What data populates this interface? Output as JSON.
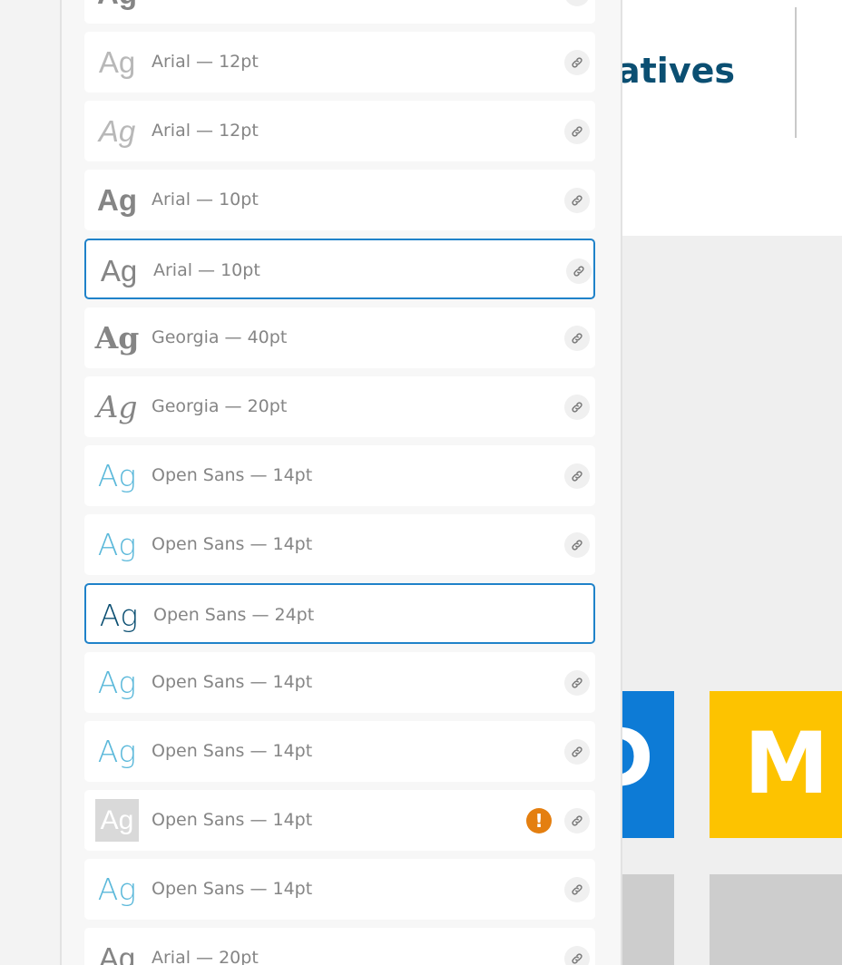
{
  "canvas": {
    "header_title": "atives",
    "tile_blue_letter": "D",
    "tile_yellow_letter": "M",
    "colors": {
      "title": "#0b4f72",
      "tile_blue": "#0d7bd6",
      "tile_yellow": "#fdc300",
      "tile_grey": "#cdcdcd"
    }
  },
  "style_list": {
    "colors": {
      "selected_border": "#1f82c9",
      "warning": "#e47f10",
      "label": "#858585"
    },
    "items": [
      {
        "preview": "Ag",
        "label": "Arial — 12pt",
        "preview_color": "#b8b8b8",
        "font": "sans",
        "weight": "normal",
        "italic": false,
        "selected": false,
        "warning": false,
        "link": true
      },
      {
        "preview": "Ag",
        "label": "Arial — 12pt",
        "preview_color": "#b8b8b8",
        "font": "sans",
        "weight": "normal",
        "italic": true,
        "selected": false,
        "warning": false,
        "link": true
      },
      {
        "preview": "Ag",
        "label": "Arial — 10pt",
        "preview_color": "#858585",
        "font": "sans",
        "weight": "bold",
        "italic": false,
        "selected": false,
        "warning": false,
        "link": true
      },
      {
        "preview": "Ag",
        "label": "Arial — 10pt",
        "preview_color": "#858585",
        "font": "sans",
        "weight": "normal",
        "italic": false,
        "selected": true,
        "warning": false,
        "link": true
      },
      {
        "preview": "Ag",
        "label": "Georgia — 40pt",
        "preview_color": "#858585",
        "font": "serif",
        "weight": "bold",
        "italic": false,
        "selected": false,
        "warning": false,
        "link": true
      },
      {
        "preview": "Ag",
        "label": "Georgia — 20pt",
        "preview_color": "#858585",
        "font": "serif",
        "weight": "normal",
        "italic": true,
        "selected": false,
        "warning": false,
        "link": true
      },
      {
        "preview": "Ag",
        "label": "Open Sans — 14pt",
        "preview_color": "#5ab8da",
        "font": "light",
        "weight": "normal",
        "italic": false,
        "selected": false,
        "warning": false,
        "link": true
      },
      {
        "preview": "Ag",
        "label": "Open Sans — 14pt",
        "preview_color": "#5ab8da",
        "font": "light",
        "weight": "normal",
        "italic": false,
        "selected": false,
        "warning": false,
        "link": true
      },
      {
        "preview": "Ag",
        "label": "Open Sans — 24pt",
        "preview_color": "#0b4f72",
        "font": "light",
        "weight": "normal",
        "italic": false,
        "selected": true,
        "warning": false,
        "link": false
      },
      {
        "preview": "Ag",
        "label": "Open Sans — 14pt",
        "preview_color": "#5ab8da",
        "font": "light",
        "weight": "normal",
        "italic": false,
        "selected": false,
        "warning": false,
        "link": true
      },
      {
        "preview": "Ag",
        "label": "Open Sans — 14pt",
        "preview_color": "#5ab8da",
        "font": "light",
        "weight": "normal",
        "italic": false,
        "selected": false,
        "warning": false,
        "link": true
      },
      {
        "preview": "Ag",
        "label": "Open Sans — 14pt",
        "preview_color": "#ffffff",
        "font": "thumb",
        "weight": "normal",
        "italic": false,
        "selected": false,
        "warning": true,
        "warning_symbol": "!",
        "link": true
      },
      {
        "preview": "Ag",
        "label": "Open Sans — 14pt",
        "preview_color": "#5ab8da",
        "font": "light",
        "weight": "normal",
        "italic": false,
        "selected": false,
        "warning": false,
        "link": true
      },
      {
        "preview": "Ag",
        "label": "Arial — 20pt",
        "preview_color": "#858585",
        "font": "sans",
        "weight": "normal",
        "italic": false,
        "selected": false,
        "warning": false,
        "link": true
      }
    ]
  }
}
